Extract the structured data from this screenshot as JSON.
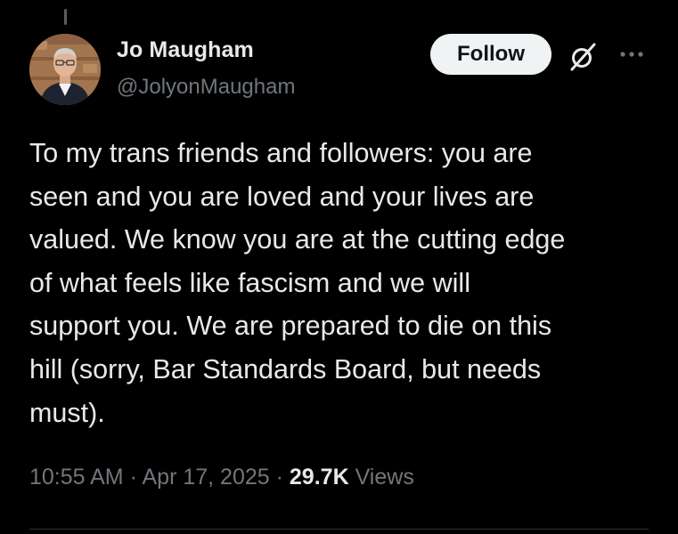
{
  "author": {
    "display_name": "Jo Maugham",
    "handle": "@JolyonMaugham"
  },
  "actions": {
    "follow_label": "Follow",
    "grok_icon": "grok-slash-circle-icon",
    "more_icon": "more-horizontal-icon"
  },
  "tweet": {
    "text": "To my trans friends and followers: you are\nseen and you are loved and your lives are\nvalued. We know you are at the cutting edge\nof what feels like fascism and we will\nsupport you. We are prepared to die on this\nhill (sorry, Bar Standards Board, but needs\nmust)."
  },
  "meta": {
    "time": "10:55 AM",
    "separator": "·",
    "date": "Apr 17, 2025",
    "views_count": "29.7K",
    "views_label": "Views"
  },
  "colors": {
    "background": "#000000",
    "primary_text": "#e7e9ea",
    "secondary_text": "#71767b",
    "follow_button_bg": "#eff3f4",
    "follow_button_text": "#0f1419",
    "divider": "#2f3336"
  }
}
